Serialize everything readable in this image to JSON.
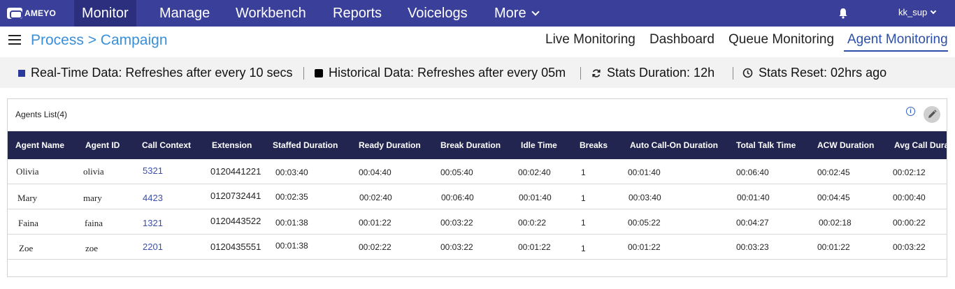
{
  "brand": "AMEYO",
  "nav": {
    "items": [
      "Monitor",
      "Manage",
      "Workbench",
      "Reports",
      "Voicelogs",
      "More"
    ],
    "active": "Monitor",
    "user": "kk_sup"
  },
  "subheader": {
    "breadcrumb": "Process > Campaign",
    "tabs": [
      "Live Monitoring",
      "Dashboard",
      "Queue Monitoring",
      "Agent Monitoring"
    ],
    "active_tab": "Agent Monitoring"
  },
  "stats": {
    "realtime": "Real-Time Data: Refreshes after every 10 secs",
    "historical": "Historical Data: Refreshes after every 05m",
    "duration": "Stats Duration: 12h",
    "reset": "Stats Reset: 02hrs ago",
    "realtime_color": "#2b3a9a",
    "historical_color": "#000000"
  },
  "panel": {
    "title": "Agents List(4)",
    "info_icon": "info-icon",
    "edit_icon": "pencil-icon"
  },
  "table": {
    "columns": [
      "Agent Name",
      "Agent ID",
      "Call Context",
      "Extension",
      "Staffed Duration",
      "Ready Duration",
      "Break Duration",
      "Idle Time",
      "Breaks",
      "Auto Call-On Duration",
      "Total Talk Time",
      "ACW Duration",
      "Avg Call Duration"
    ],
    "rows": [
      [
        "Olivia",
        "olivia",
        "5321",
        "0120441221",
        "00:03:40",
        "00:04:40",
        "00:05:40",
        "00:02:40",
        "1",
        "00:01:40",
        "00:06:40",
        "00:02:45",
        "00:02:12"
      ],
      [
        "Mary",
        "mary",
        "4423",
        "0120732441",
        "00:02:35",
        "00:02:40",
        "00:06:40",
        "00:01:40",
        "1",
        "00:03:40",
        "00:01:40",
        "00:04:45",
        "00:00:40"
      ],
      [
        "Faina",
        "faina",
        "1321",
        "0120443522",
        "00:01:38",
        "00:01:22",
        "00:03:22",
        "00:0:22",
        "1",
        "00:05:22",
        "00:04:27",
        "00:02:18",
        "00:00:22"
      ],
      [
        "Zoe",
        "zoe",
        "2201",
        "0120435551",
        "00:01:38",
        "00:02:22",
        "00:03:22",
        "00:01:22",
        "1",
        "00:01:22",
        "00:03:23",
        "00:01:22",
        "00:03:22"
      ]
    ]
  },
  "colors": {
    "nav_bg": "#3a3f9a",
    "nav_active": "#2b2f7d",
    "table_header": "#22254f",
    "link": "#3a4fa8",
    "breadcrumb": "#3a8fd8"
  }
}
